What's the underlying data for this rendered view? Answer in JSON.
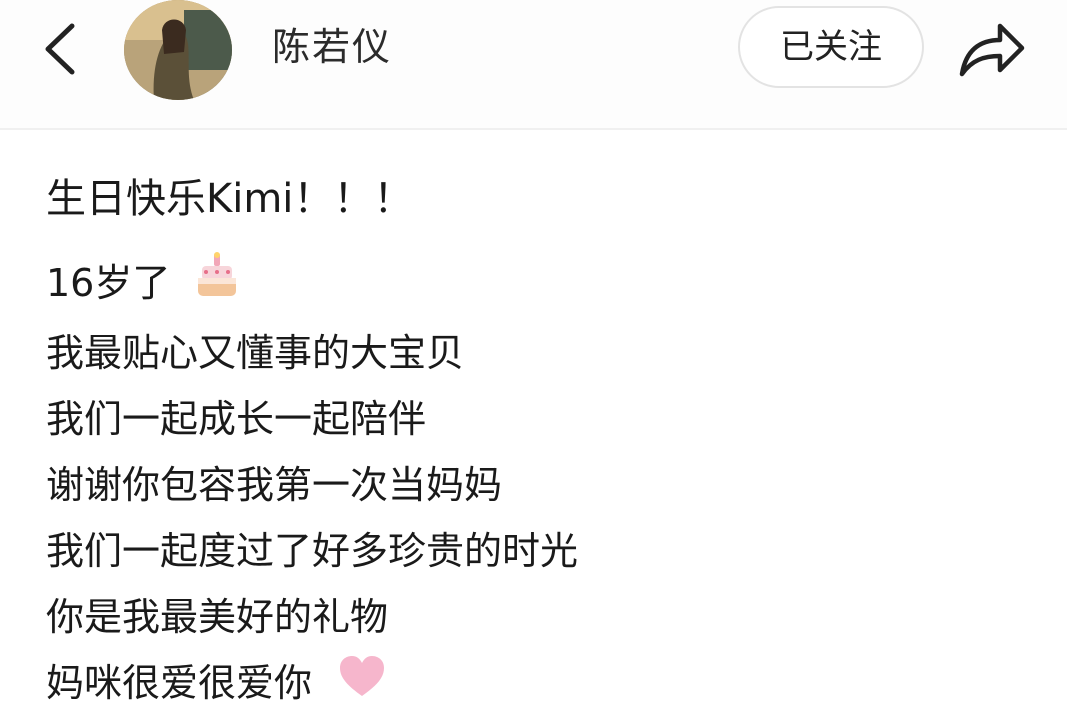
{
  "header": {
    "username": "陈若仪",
    "follow_label": "已关注"
  },
  "post": {
    "title": "生日快乐Kimi！！！",
    "lines": [
      "16岁了",
      "我最贴心又懂事的大宝贝",
      "我们一起成长一起陪伴",
      "谢谢你包容我第一次当妈妈",
      "我们一起度过了好多珍贵的时光",
      "你是我最美好的礼物",
      "妈咪很爱很爱你"
    ]
  }
}
